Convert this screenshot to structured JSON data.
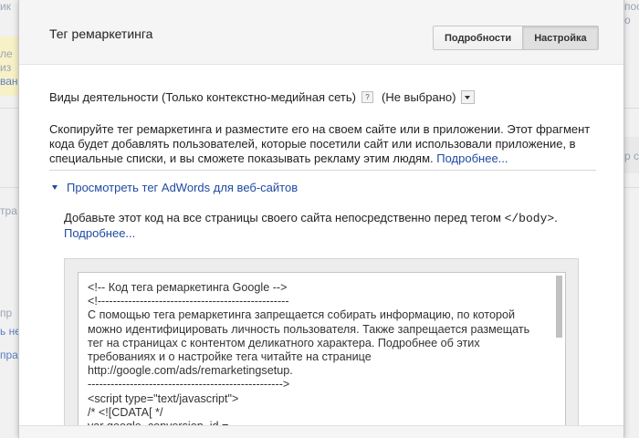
{
  "background": {
    "fragments": [
      "ик",
      "ле",
      "из",
      "ван",
      "тра",
      "пр",
      "ь не",
      "пра",
      "р ст",
      "пос",
      "о"
    ]
  },
  "dialog": {
    "title": "Тег ремаркетинга",
    "buttons": {
      "details": "Подробности",
      "settings": "Настройка"
    },
    "category": {
      "label": "Виды деятельности (Только контекстно-медийная сеть)",
      "help": "?",
      "value": "(Не выбрано)"
    },
    "description": "Скопируйте тег ремаркетинга и разместите его на своем сайте или в приложении. Этот фрагмент кода будет добавлять пользователей, которые посетили сайт или использовали приложение, в специальные списки, и вы сможете показывать рекламу этим людям.",
    "more_link": "Подробнее...",
    "view_toggle": "Просмотреть тег AdWords для веб-сайтов",
    "instruction": "Добавьте этот код на все страницы своего сайта непосредственно перед тегом",
    "instruction_code": "</body>",
    "instruction_end": ".",
    "instruction_more": "Подробнее...",
    "code": "<!-- Код тега ремаркетинга Google -->\n<!--------------------------------------------------\nС помощью тега ремаркетинга запрещается собирать информацию, по которой можно идентифицировать личность пользователя. Также запрещается размещать тег на страницах с контентом деликатного характера. Подробнее об этих требованиях и о настройке тега читайте на странице\nhttp://google.com/ads/remarketingsetup.\n--------------------------------------------------->\n<script type=\"text/javascript\">\n/* <![CDATA[ */\nvar google_conversion_id ="
  },
  "colors": {
    "link": "#1f4aa1",
    "header_bg": "#f5f5f5",
    "active_button_bg": "#e0e0e0"
  }
}
